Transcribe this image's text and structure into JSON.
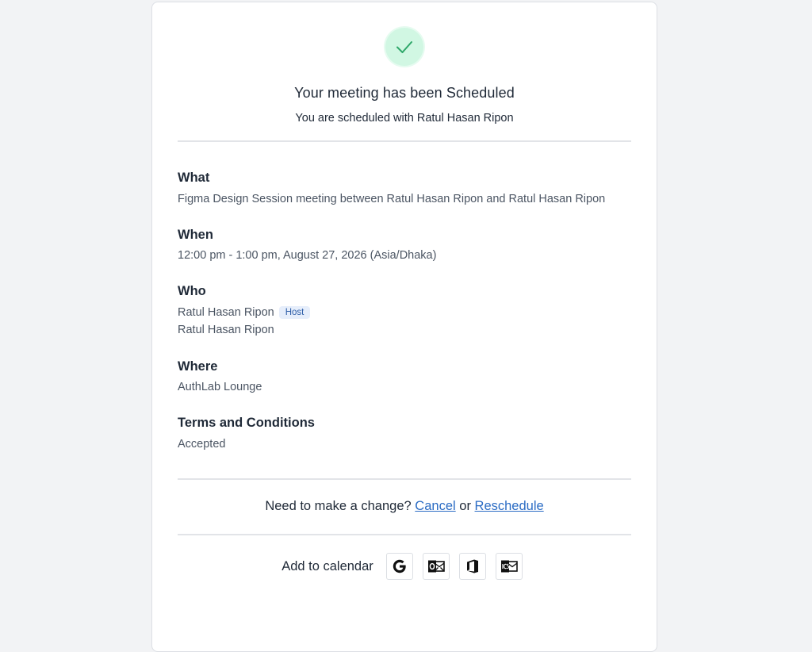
{
  "confirmation": {
    "heading": "Your meeting has been Scheduled",
    "subheading": "You are scheduled with Ratul Hasan Ripon"
  },
  "details": {
    "what": {
      "title": "What",
      "text": "Figma Design Session meeting between Ratul Hasan Ripon and Ratul Hasan Ripon"
    },
    "when": {
      "title": "When",
      "text": "12:00 pm - 1:00 pm, August 27, 2026 (Asia/Dhaka)"
    },
    "who": {
      "title": "Who",
      "host_name": "Ratul Hasan Ripon",
      "host_badge": "Host",
      "guest_name": "Ratul Hasan Ripon"
    },
    "where": {
      "title": "Where",
      "text": "AuthLab Lounge"
    },
    "terms": {
      "title": "Terms and Conditions",
      "text": "Accepted"
    }
  },
  "change": {
    "prompt": "Need to make a change?",
    "cancel_label": "Cancel",
    "or_text": "or",
    "reschedule_label": "Reschedule"
  },
  "calendar": {
    "label": "Add to calendar",
    "options": [
      {
        "icon": "google-calendar-icon"
      },
      {
        "icon": "outlook-calendar-icon"
      },
      {
        "icon": "office365-calendar-icon"
      },
      {
        "icon": "ics-download-icon"
      }
    ]
  },
  "colors": {
    "background": "#f2f3f5",
    "success_circle": "#d1f7e3",
    "success_check": "#2fa86a",
    "link": "#2b6cc4",
    "badge_bg": "#e6eefb",
    "badge_text": "#2f5fa8"
  }
}
